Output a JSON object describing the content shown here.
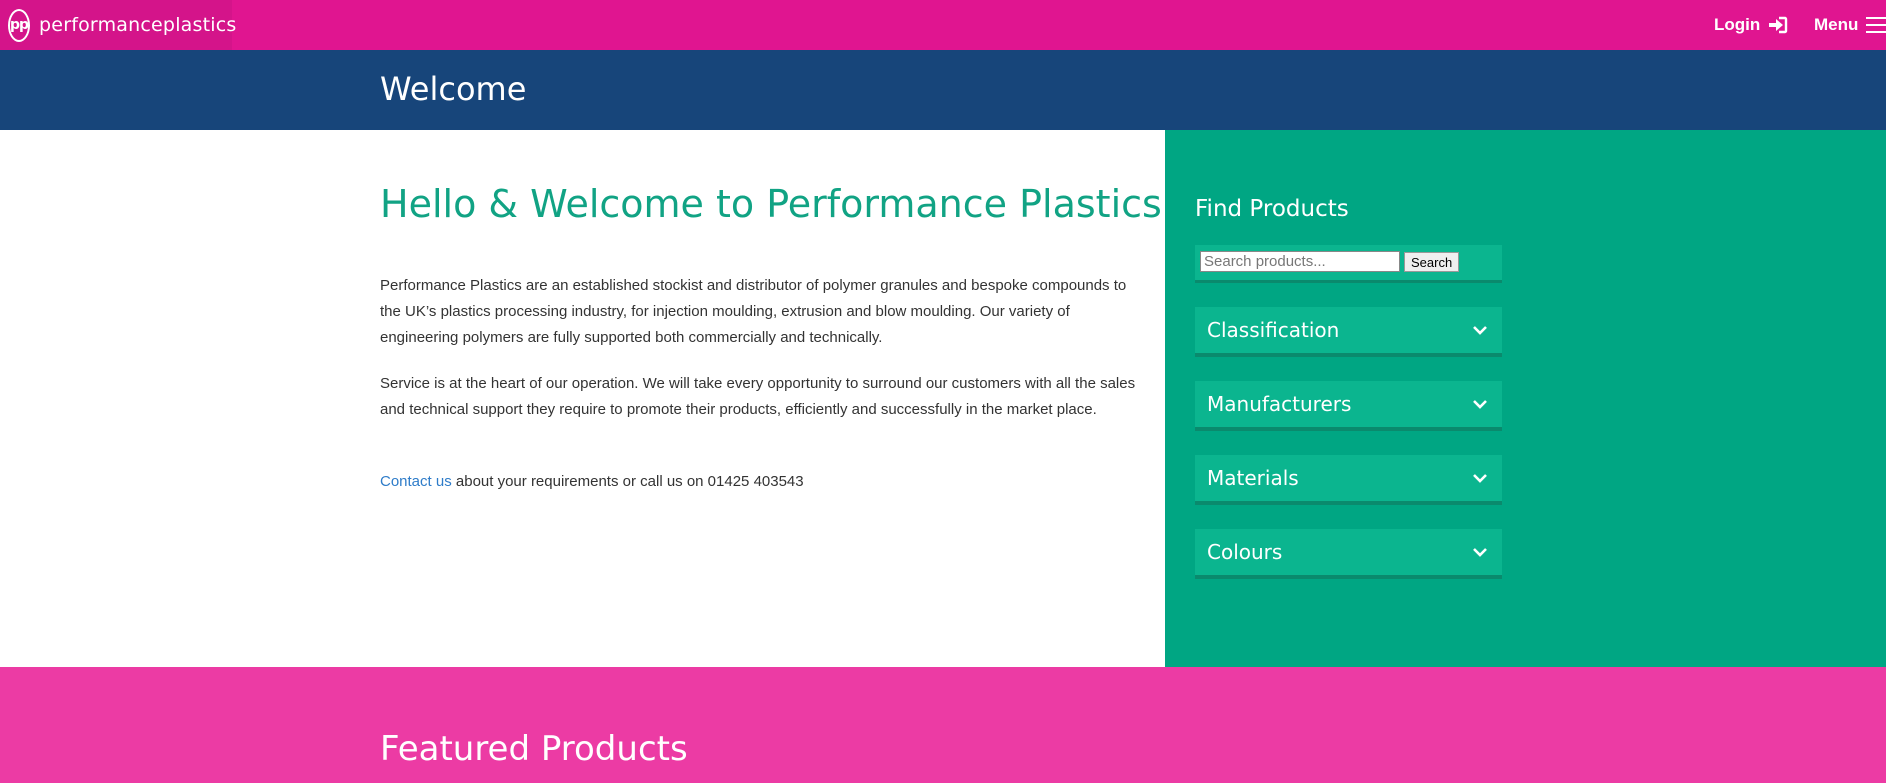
{
  "topbar": {
    "logo_mark": "pp",
    "logo_text": "performanceplastics",
    "login_label": "Login",
    "menu_label": "Menu",
    "bg_color": "#e01590"
  },
  "header": {
    "title": "Welcome",
    "bg_color": "#17457a"
  },
  "main": {
    "heading": "Hello & Welcome to Performance Plastics",
    "paragraph1": "Performance Plastics are an established stockist and distributor of polymer granules and bespoke compounds to the UK’s plastics processing industry, for injection moulding, extrusion and blow moulding. Our variety of engineering polymers are fully supported both commercially and technically.",
    "paragraph2": "Service is at the heart of our operation. We will take every opportunity to surround our customers with all the sales and technical support they require to promote their products, efficiently and successfully in the market place.",
    "contact_link": "Contact us",
    "contact_rest": " about your requirements or call us on 01425 403543"
  },
  "sidebar": {
    "title": "Find Products",
    "search": {
      "placeholder": "Search products...",
      "button_label": "Search"
    },
    "accordions": [
      {
        "label": "Classification"
      },
      {
        "label": "Manufacturers"
      },
      {
        "label": "Materials"
      },
      {
        "label": "Colours"
      }
    ],
    "bg_color": "#00a683"
  },
  "featured": {
    "title": "Featured Products",
    "bg_color": "#ec3ba4"
  }
}
